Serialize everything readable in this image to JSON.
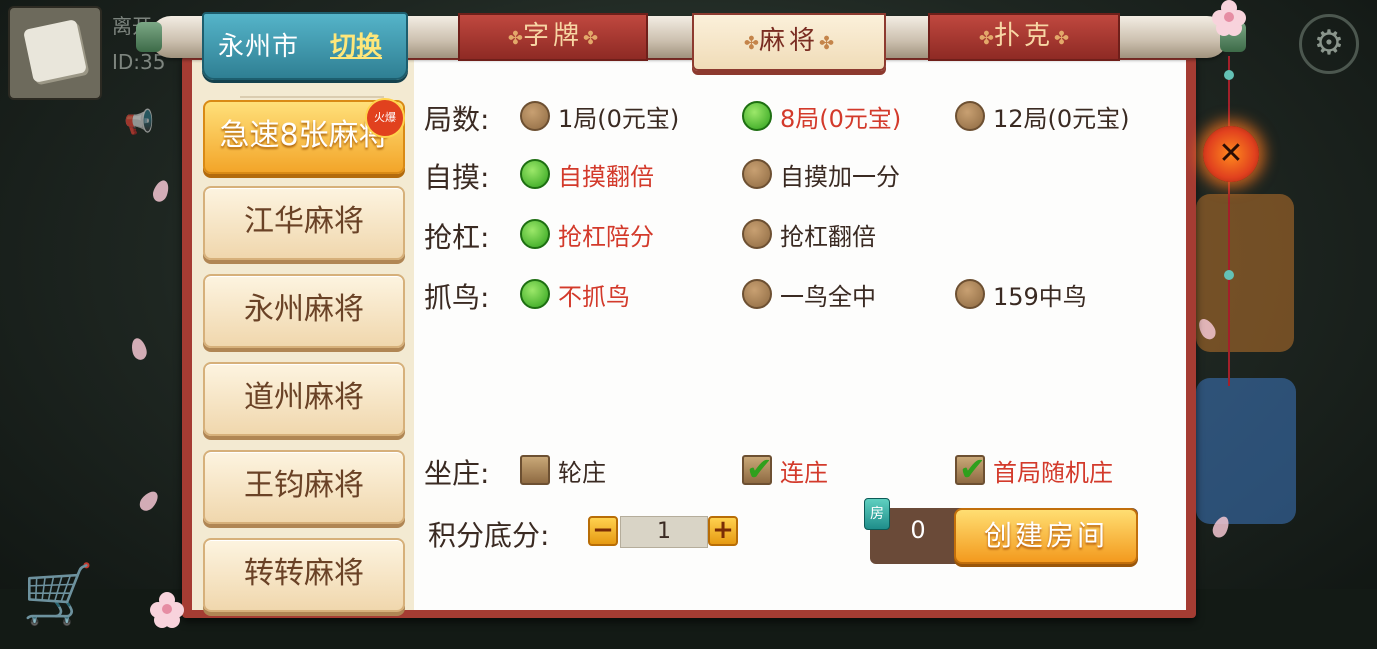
{
  "background": {
    "player_name": "离开",
    "player_id": "ID:35"
  },
  "city": {
    "name": "永州市",
    "switch_label": "切换"
  },
  "categories": [
    {
      "label": "字牌",
      "active": false
    },
    {
      "label": "麻将",
      "active": true
    },
    {
      "label": "扑克",
      "active": false
    }
  ],
  "games": [
    {
      "label": "急速8张麻将",
      "selected": true,
      "badge": "火爆"
    },
    {
      "label": "江华麻将",
      "selected": false
    },
    {
      "label": "永州麻将",
      "selected": false
    },
    {
      "label": "道州麻将",
      "selected": false
    },
    {
      "label": "王钧麻将",
      "selected": false
    },
    {
      "label": "转转麻将",
      "selected": false
    }
  ],
  "options": {
    "rounds": {
      "label": "局数:",
      "choices": [
        "1局(0元宝)",
        "8局(0元宝)",
        "12局(0元宝)"
      ],
      "selected": 1
    },
    "self_draw": {
      "label": "自摸:",
      "choices": [
        "自摸翻倍",
        "自摸加一分"
      ],
      "selected": 0
    },
    "kong": {
      "label": "抢杠:",
      "choices": [
        "抢杠陪分",
        "抢杠翻倍"
      ],
      "selected": 0
    },
    "bird": {
      "label": "抓鸟:",
      "choices": [
        "不抓鸟",
        "一鸟全中",
        "159中鸟"
      ],
      "selected": 0
    },
    "dealer": {
      "label": "坐庄:",
      "choices": [
        "轮庄",
        "连庄",
        "首局随机庄"
      ],
      "checked": [
        false,
        true,
        true
      ]
    }
  },
  "score": {
    "label": "积分底分:",
    "minus": "−",
    "plus": "+",
    "value": "1"
  },
  "room": {
    "cost_icon": "房",
    "cost": "0",
    "create_label": "创建房间"
  },
  "close_label": "✕",
  "colors": {
    "panel_border": "#a53c33",
    "selected_text": "#d33a2b",
    "radio_on": "#2ea11c",
    "button_gold": "#f3a529"
  }
}
